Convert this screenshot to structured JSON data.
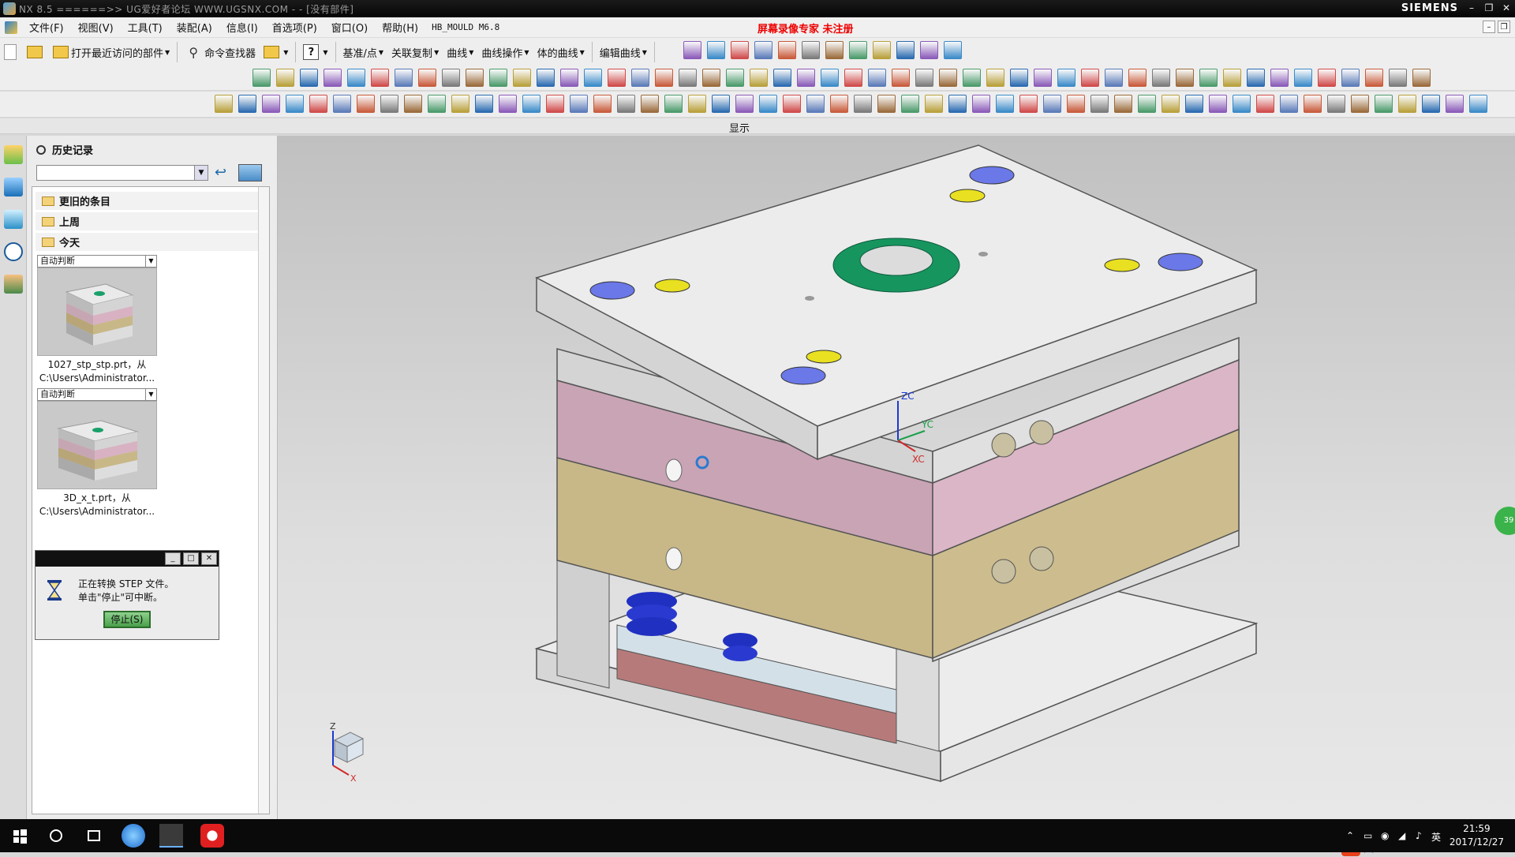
{
  "titlebar": {
    "title": "NX 8.5  ======>>  UG爱好者论坛  WWW.UGSNX.COM -  - [没有部件]",
    "brand": "SIEMENS",
    "buttons": [
      "–",
      "❐",
      "✕"
    ]
  },
  "menubar": {
    "items": [
      "文件(F)",
      "视图(V)",
      "工具(T)",
      "装配(A)",
      "信息(I)",
      "首选项(P)",
      "窗口(O)",
      "帮助(H)"
    ],
    "module": "HB_MOULD M6.8",
    "recording": "屏幕录像专家  未注册"
  },
  "toolbar": {
    "recent_parts": "打开最近访问的部件",
    "command_finder": "命令查找器",
    "datum_point": "基准/点",
    "assoc_copy": "关联复制",
    "curve": "曲线",
    "curve_ops": "曲线操作",
    "body_curve": "体的曲线",
    "edit_curve": "编辑曲线"
  },
  "display_bar": {
    "label": "显示"
  },
  "history": {
    "title": "历史记录",
    "groups": [
      "更旧的条目",
      "上周",
      "今天"
    ],
    "entries": [
      {
        "mode": "自动判断",
        "name": "1027_stp_stp.prt，从",
        "path": "C:\\Users\\Administrator..."
      },
      {
        "mode": "自动判断",
        "name": "3D_x_t.prt，从",
        "path": "C:\\Users\\Administrator..."
      }
    ]
  },
  "dialog": {
    "line1": "正在转换 STEP 文件。",
    "line2": "单击\"停止\"可中断。",
    "stop": "停止(S)"
  },
  "viewport": {
    "axis_zc": "ZC",
    "axis_yc": "YC",
    "axis_xc": "XC",
    "triad_z": "Z",
    "triad_x": "X",
    "badge": "39",
    "colors": {
      "plate": "#e0e0e0",
      "pink": "#d8b2c2",
      "khaki": "#c8b888",
      "ring": "#1aa06a",
      "hole_blue": "#6a78e8",
      "screw_yellow": "#e8e020"
    }
  },
  "ime": {
    "lang": "英"
  },
  "taskbar": {
    "time": "21:59",
    "date": "2017/12/27",
    "lang": "英"
  }
}
